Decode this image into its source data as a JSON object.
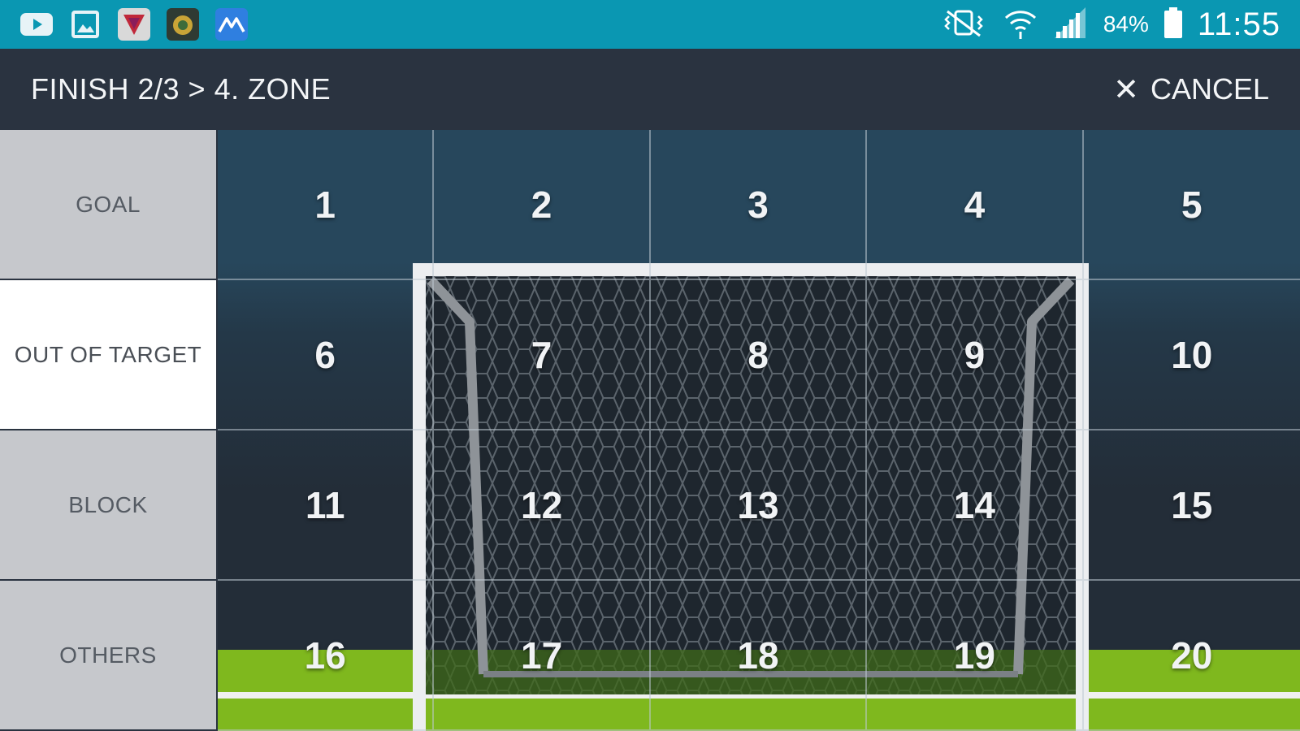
{
  "status_bar": {
    "notification_icons": [
      "youtube-icon",
      "gallery-icon",
      "shield-app-icon",
      "badge-app-icon",
      "mountain-app-icon"
    ],
    "battery": "84%",
    "time": "11:55"
  },
  "header": {
    "breadcrumb": "FINISH 2/3 > 4. ZONE",
    "cancel_icon": "close-icon",
    "cancel_label": "CANCEL"
  },
  "results": [
    {
      "label": "GOAL",
      "selected": false
    },
    {
      "label": "OUT OF TARGET",
      "selected": true
    },
    {
      "label": "BLOCK",
      "selected": false
    },
    {
      "label": "OTHERS",
      "selected": false
    }
  ],
  "zones": [
    "1",
    "2",
    "3",
    "4",
    "5",
    "6",
    "7",
    "8",
    "9",
    "10",
    "11",
    "12",
    "13",
    "14",
    "15",
    "16",
    "17",
    "18",
    "19",
    "20"
  ],
  "colors": {
    "status_bar": "#0a97b2",
    "header": "#2a3340",
    "grass": "#7fb81e",
    "button_bg": "#c6c8cc",
    "button_selected": "#ffffff"
  }
}
